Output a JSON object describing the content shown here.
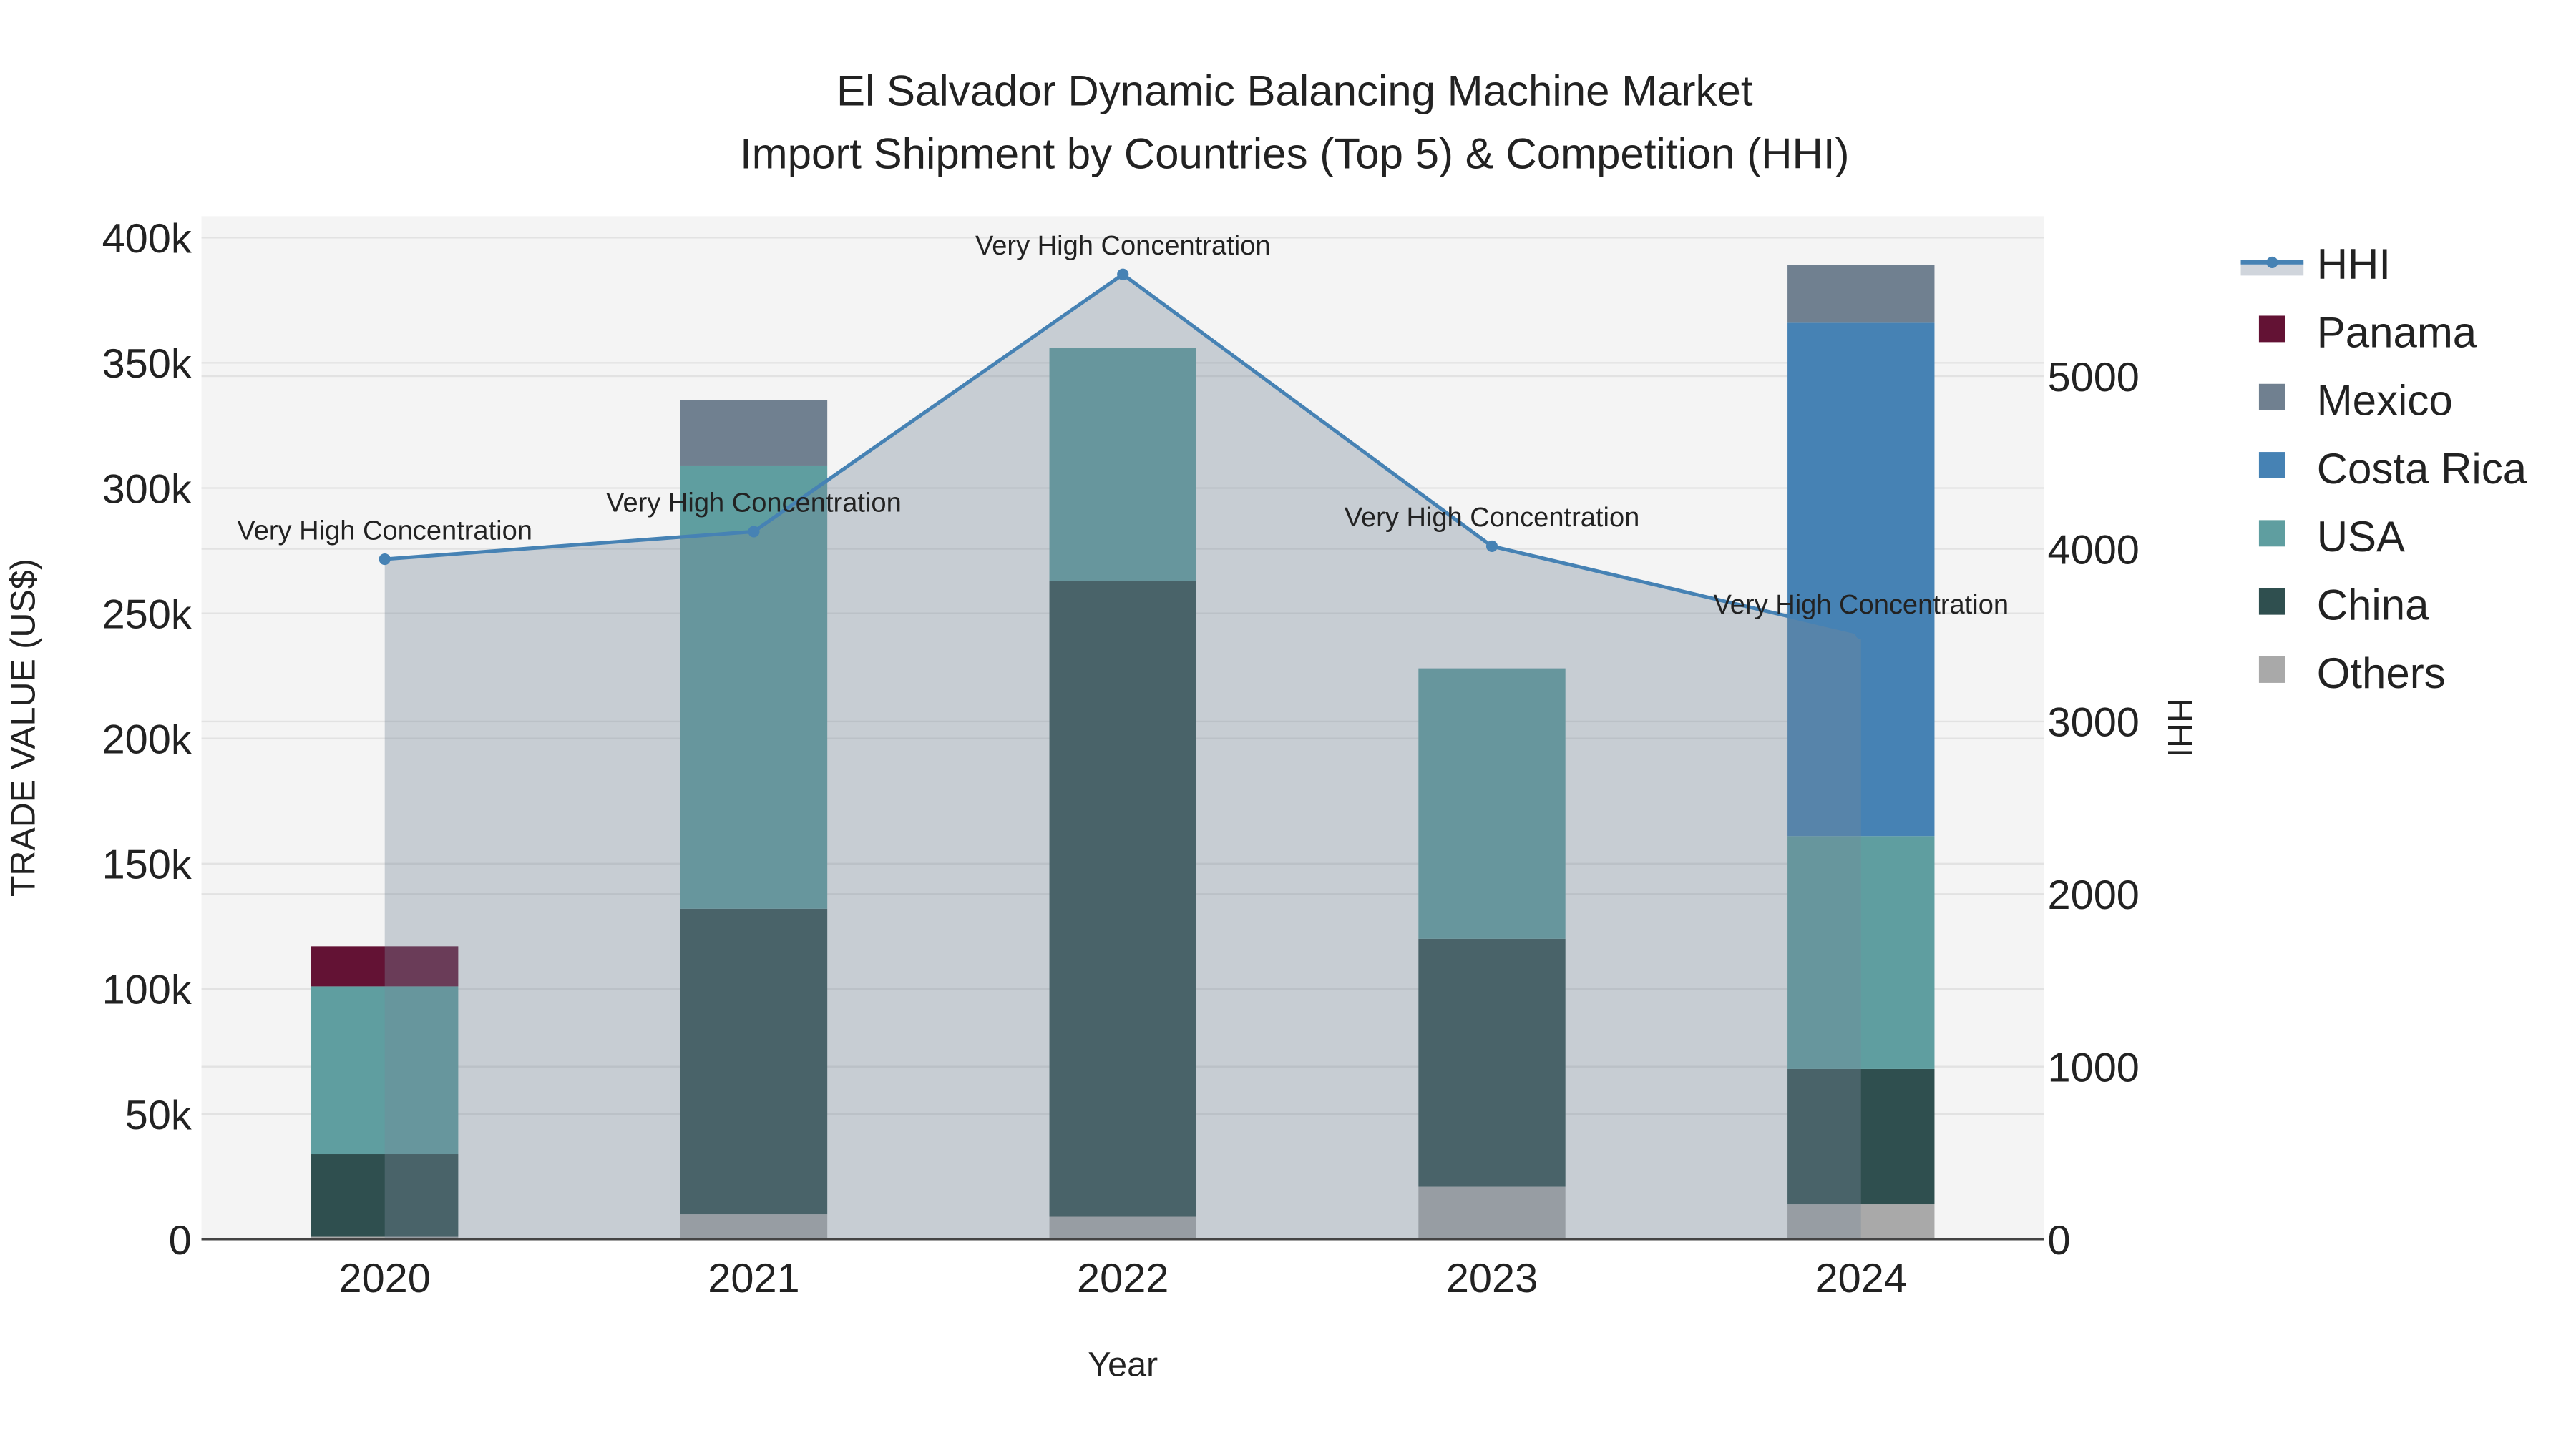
{
  "chart_data": {
    "type": "bar",
    "stacked": true,
    "title_line1": "El Salvador Dynamic Balancing Machine Market",
    "title_line2": "Import Shipment by Countries (Top 5) & Competition (HHI)",
    "xlabel": "Year",
    "ylabel": "TRADE VALUE (US$)",
    "y2label": "HHI",
    "categories": [
      "2020",
      "2021",
      "2022",
      "2023",
      "2024"
    ],
    "ylim": [
      0,
      400000
    ],
    "y2lim": [
      0,
      5800
    ],
    "yticks": [
      0,
      50000,
      100000,
      150000,
      200000,
      250000,
      300000,
      350000,
      400000
    ],
    "ytick_labels": [
      "0",
      "50k",
      "100k",
      "150k",
      "200k",
      "250k",
      "300k",
      "350k",
      "400k"
    ],
    "y2ticks": [
      0,
      1000,
      2000,
      3000,
      4000,
      5000
    ],
    "y2tick_labels": [
      "0",
      "1000",
      "2000",
      "3000",
      "4000",
      "5000"
    ],
    "grid": true,
    "legend_position": "right",
    "series": [
      {
        "name": "Others",
        "color": "#a9a9a9",
        "values": [
          1000,
          10000,
          9000,
          21000,
          14000
        ]
      },
      {
        "name": "China",
        "color": "#2f4f4f",
        "values": [
          33000,
          122000,
          254000,
          99000,
          54000
        ]
      },
      {
        "name": "USA",
        "color": "#5f9ea0",
        "values": [
          67000,
          177000,
          93000,
          108000,
          93000
        ]
      },
      {
        "name": "Costa Rica",
        "color": "#4682b4",
        "values": [
          0,
          0,
          0,
          0,
          205000
        ]
      },
      {
        "name": "Mexico",
        "color": "#708090",
        "values": [
          0,
          26000,
          0,
          0,
          23000
        ]
      },
      {
        "name": "Panama",
        "color": "#631234",
        "values": [
          16000,
          0,
          0,
          0,
          0
        ]
      }
    ],
    "hhi": {
      "name": "HHI",
      "color": "#4682b4",
      "values": [
        3940,
        4100,
        5590,
        4015,
        3510
      ],
      "annotations": [
        "Very High Concentration",
        "Very High Concentration",
        "Very High Concentration",
        "Very High Concentration",
        "Very High Concentration"
      ]
    },
    "legend_order": [
      "HHI",
      "Panama",
      "Mexico",
      "Costa Rica",
      "USA",
      "China",
      "Others"
    ]
  }
}
